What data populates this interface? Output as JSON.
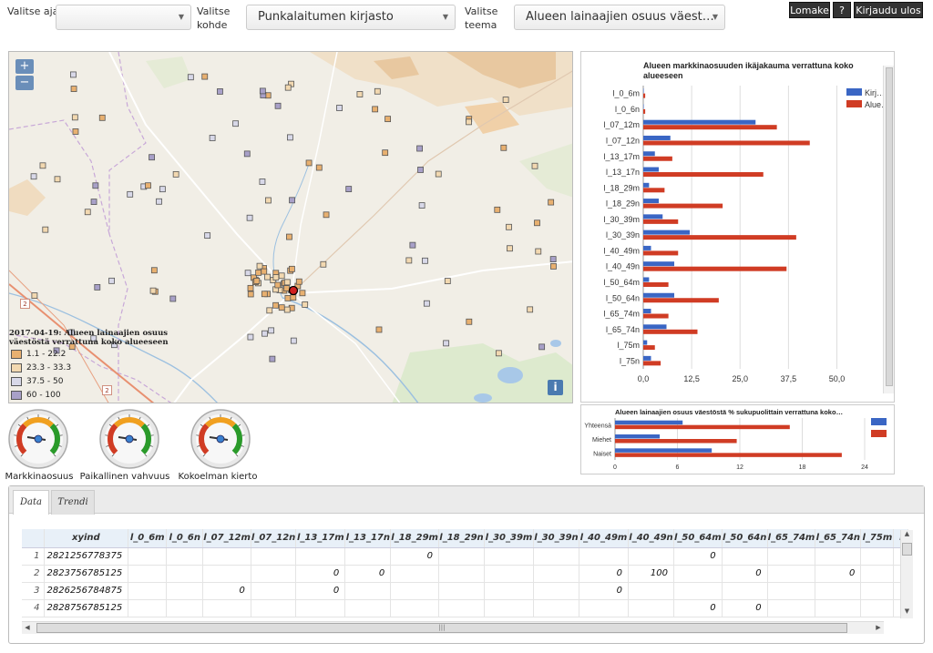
{
  "header": {
    "ajankohta_label": "Valitse ajankohta",
    "ajankohta_value": "",
    "kohde_label": "Valitse kohde",
    "kohde_value": "Punkalaitumen kirjasto",
    "teema_label": "Valitse teema",
    "teema_value": "Alueen lainaajien osuus väest…",
    "buttons": {
      "lomake": "Lomake",
      "help": "?",
      "logout": "Kirjaudu ulos"
    }
  },
  "map": {
    "zoom_in": "+",
    "zoom_out": "−",
    "info": "i",
    "road_labels": [
      "2",
      "2"
    ],
    "legend": {
      "title": "2017-04-19: Alueen lainaajien osuus väestöstä verrattuna koko alueeseen",
      "items": [
        {
          "label": "1.1 - 22.2",
          "color": "#e8b070"
        },
        {
          "label": "23.3 - 33.3",
          "color": "#f2d8b0"
        },
        {
          "label": "37.5 - 50",
          "color": "#d8d8e8"
        },
        {
          "label": "60 - 100",
          "color": "#a8a0c8"
        }
      ]
    }
  },
  "gauges": [
    {
      "label": "Markkinaosuus"
    },
    {
      "label": "Paikallinen vahvuus"
    },
    {
      "label": "Kokoelman kierto"
    }
  ],
  "chart_data": [
    {
      "type": "bar",
      "title": "Alueen markkinaosuuden ikäjakauma verrattuna koko alueeseen",
      "categories": [
        "l_0_6m",
        "l_0_6n",
        "l_07_12m",
        "l_07_12n",
        "l_13_17m",
        "l_13_17n",
        "l_18_29m",
        "l_18_29n",
        "l_30_39m",
        "l_30_39n",
        "l_40_49m",
        "l_40_49n",
        "l_50_64m",
        "l_50_64n",
        "l_65_74m",
        "l_65_74n",
        "l_75m",
        "l_75n"
      ],
      "series": [
        {
          "name": "Kirj…",
          "color": "#3a66c4",
          "values": [
            0,
            0,
            29,
            7,
            3,
            4,
            1.5,
            4,
            5,
            12,
            2,
            8,
            1.5,
            8,
            2,
            6,
            1,
            2
          ]
        },
        {
          "name": "Alue…",
          "color": "#d03c24",
          "values": [
            0.5,
            0.5,
            34.5,
            43,
            7.5,
            31,
            5.5,
            20.5,
            9,
            39.5,
            9,
            37,
            6.5,
            19.5,
            6.5,
            14,
            3,
            4.5
          ]
        }
      ],
      "xticks": [
        "0,0",
        "12,5",
        "25,0",
        "37,5",
        "50,0"
      ],
      "xlim": [
        0,
        60
      ],
      "orientation": "horizontal",
      "grid": true,
      "legend": "top-right"
    },
    {
      "type": "bar",
      "title": "Alueen lainaajien osuus väestöstä % sukupuolittain verrattuna koko…",
      "categories": [
        "Yhteensä",
        "Miehet",
        "Naiset"
      ],
      "series": [
        {
          "name": "",
          "color": "#3a66c4",
          "values": [
            6.5,
            4.3,
            9.3
          ]
        },
        {
          "name": "",
          "color": "#d03c24",
          "values": [
            16.8,
            11.7,
            21.8
          ]
        }
      ],
      "xticks": [
        "0",
        "6",
        "12",
        "18",
        "24"
      ],
      "xlim": [
        0,
        24
      ],
      "orientation": "horizontal",
      "grid": true,
      "legend": "right"
    }
  ],
  "tabs": [
    {
      "label": "Data"
    },
    {
      "label": "Trendi"
    }
  ],
  "table": {
    "columns": [
      "",
      "xyind",
      "l_0_6m",
      "l_0_6n",
      "l_07_12m",
      "l_07_12n",
      "l_13_17m",
      "l_13_17n",
      "l_18_29m",
      "l_18_29n",
      "l_30_39m",
      "l_30_39n",
      "l_40_49m",
      "l_40_49n",
      "l_50_64m",
      "l_50_64n",
      "l_65_74m",
      "l_65_74n",
      "l_75m",
      "l"
    ],
    "rows": [
      [
        "1",
        "2821256778375",
        "",
        "",
        "",
        "",
        "",
        "",
        "0",
        "",
        "",
        "",
        "",
        "",
        "0",
        "",
        "",
        "",
        "",
        ""
      ],
      [
        "2",
        "2823756785125",
        "",
        "",
        "",
        "",
        "0",
        "0",
        "",
        "",
        "",
        "",
        "0",
        "100",
        "",
        "0",
        "",
        "0",
        "",
        ""
      ],
      [
        "3",
        "2826256784875",
        "",
        "",
        "0",
        "",
        "0",
        "",
        "",
        "",
        "",
        "",
        "0",
        "",
        "",
        "",
        "",
        "",
        "",
        ""
      ],
      [
        "4",
        "2828756785125",
        "",
        "",
        "",
        "",
        "",
        "",
        "",
        "",
        "",
        "",
        "",
        "",
        "0",
        "0",
        "",
        "",
        "",
        ""
      ]
    ]
  }
}
